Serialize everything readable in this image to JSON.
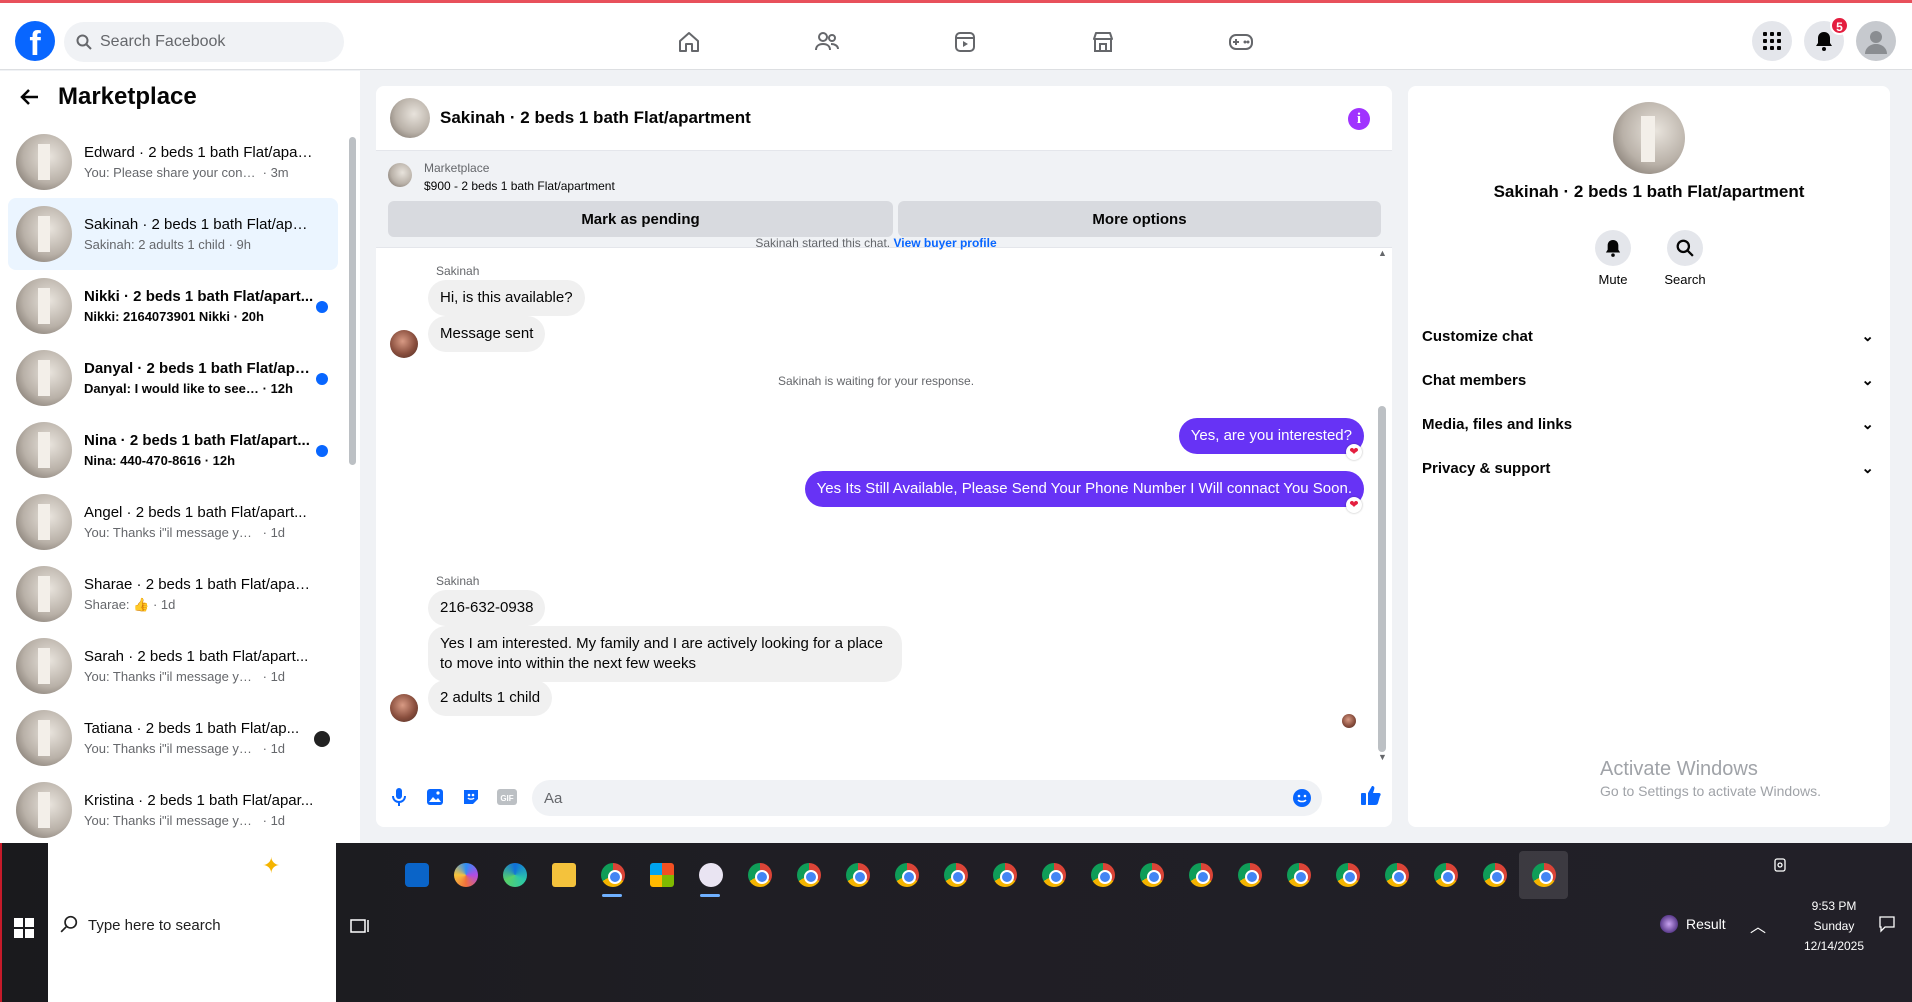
{
  "topbar": {
    "search_placeholder": "Search Facebook",
    "notification_count": "5",
    "nav": [
      "home-icon",
      "friends-icon",
      "video-icon",
      "marketplace-icon",
      "gaming-icon"
    ]
  },
  "sidebar": {
    "title": "Marketplace",
    "conversations": [
      {
        "name": "Edward · 2 beds 1 bath Flat/apar...",
        "snippet": "You: Please share your contact nu...",
        "time": "· 3m",
        "unread": false
      },
      {
        "name": "Sakinah · 2 beds 1 bath Flat/apar...",
        "snippet": "Sakinah: 2 adults 1 child",
        "time": "· 9h",
        "unread": false,
        "active": true
      },
      {
        "name": "Nikki · 2 beds 1 bath Flat/apart...",
        "snippet": "Nikki: 2164073901 Nikki",
        "time": "· 20h",
        "unread": true
      },
      {
        "name": "Danyal · 2 beds 1 bath Flat/apa...",
        "snippet": "Danyal: I would like to see it fir...",
        "time": "· 12h",
        "unread": true
      },
      {
        "name": "Nina · 2 beds 1 bath Flat/apart...",
        "snippet": "Nina: 440-470-8616",
        "time": "· 12h",
        "unread": true
      },
      {
        "name": "Angel · 2 beds 1 bath Flat/apart...",
        "snippet": "You: Thanks i\"il message you in a ...",
        "time": "· 1d",
        "unread": false
      },
      {
        "name": "Sharae · 2 beds 1 bath Flat/apart...",
        "snippet": "Sharae: 👍",
        "time": "· 1d",
        "unread": false
      },
      {
        "name": "Sarah · 2 beds 1 bath Flat/apart...",
        "snippet": "You: Thanks i\"il message you in a ...",
        "time": "· 1d",
        "unread": false
      },
      {
        "name": "Tatiana · 2 beds 1 bath Flat/ap...",
        "snippet": "You: Thanks i\"il message you in ...",
        "time": "· 1d",
        "unread": false
      },
      {
        "name": "Kristina · 2 beds 1 bath Flat/apar...",
        "snippet": "You: Thanks i\"il message you in a ...",
        "time": "· 1d",
        "unread": false
      }
    ]
  },
  "chat": {
    "title": "Sakinah · 2 beds 1 bath Flat/apartment",
    "marketplace_label": "Marketplace",
    "listing": "$900 - 2 beds 1 bath Flat/apartment",
    "mark_pending": "Mark as pending",
    "more_options": "More options",
    "started_text": "Sakinah started this chat.",
    "view_profile": "View buyer profile",
    "sender": "Sakinah",
    "msg1": "Hi, is this available?",
    "msg2": "Message sent",
    "waiting": "Sakinah is waiting for your response.",
    "out1": "Yes, are you interested?",
    "out2": "Yes Its Still Available, Please Send Your Phone Number I Will connact You Soon.",
    "sender2": "Sakinah",
    "msg3": "216-632-0938",
    "msg4": "Yes I am interested. My family and I are actively looking for a place to move into within the next few weeks",
    "msg5": "2 adults 1 child",
    "composer_placeholder": "Aa"
  },
  "details": {
    "name": "Sakinah · 2 beds 1 bath Flat/apartment",
    "mute": "Mute",
    "search": "Search",
    "menu": [
      "Customize chat",
      "Chat members",
      "Media, files and links",
      "Privacy & support"
    ],
    "activate_title": "Activate Windows",
    "activate_sub": "Go to Settings to activate Windows."
  },
  "taskbar": {
    "search_placeholder": "Type here to search",
    "tray_label": "Result",
    "time": "9:53 PM",
    "day": "Sunday",
    "date": "12/14/2025"
  }
}
